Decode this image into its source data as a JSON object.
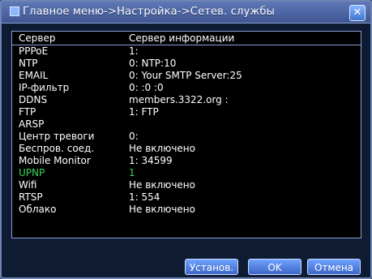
{
  "window": {
    "title": "Главное меню->Настройка->Сетев. службы",
    "close_label": "✕"
  },
  "table": {
    "columns": [
      "Сервер",
      "Сервер информации"
    ],
    "rows": [
      {
        "server": "PPPoE",
        "info": "1:"
      },
      {
        "server": "NTP",
        "info": "0: NTP:10"
      },
      {
        "server": "EMAIL",
        "info": "0: Your SMTP Server:25"
      },
      {
        "server": "IP-фильтр",
        "info": "0: :0 :0"
      },
      {
        "server": "DDNS",
        "info": "members.3322.org :"
      },
      {
        "server": "FTP",
        "info": "1: FTP"
      },
      {
        "server": "ARSP",
        "info": ""
      },
      {
        "server": "Центр тревоги",
        "info": "0:"
      },
      {
        "server": "Беспров. соед.",
        "info": "Не включено"
      },
      {
        "server": "Mobile Monitor",
        "info": "1: 34599"
      },
      {
        "server": "UPNP",
        "info": "1"
      },
      {
        "server": "Wifi",
        "info": "Не включено"
      },
      {
        "server": "RTSP",
        "info": "1: 554"
      },
      {
        "server": "Облако",
        "info": "Не включено"
      }
    ]
  },
  "buttons": {
    "apply": "Установ.",
    "ok": "OK",
    "cancel": "Отмена"
  },
  "colors": {
    "highlight_row": "#3ad65a"
  }
}
